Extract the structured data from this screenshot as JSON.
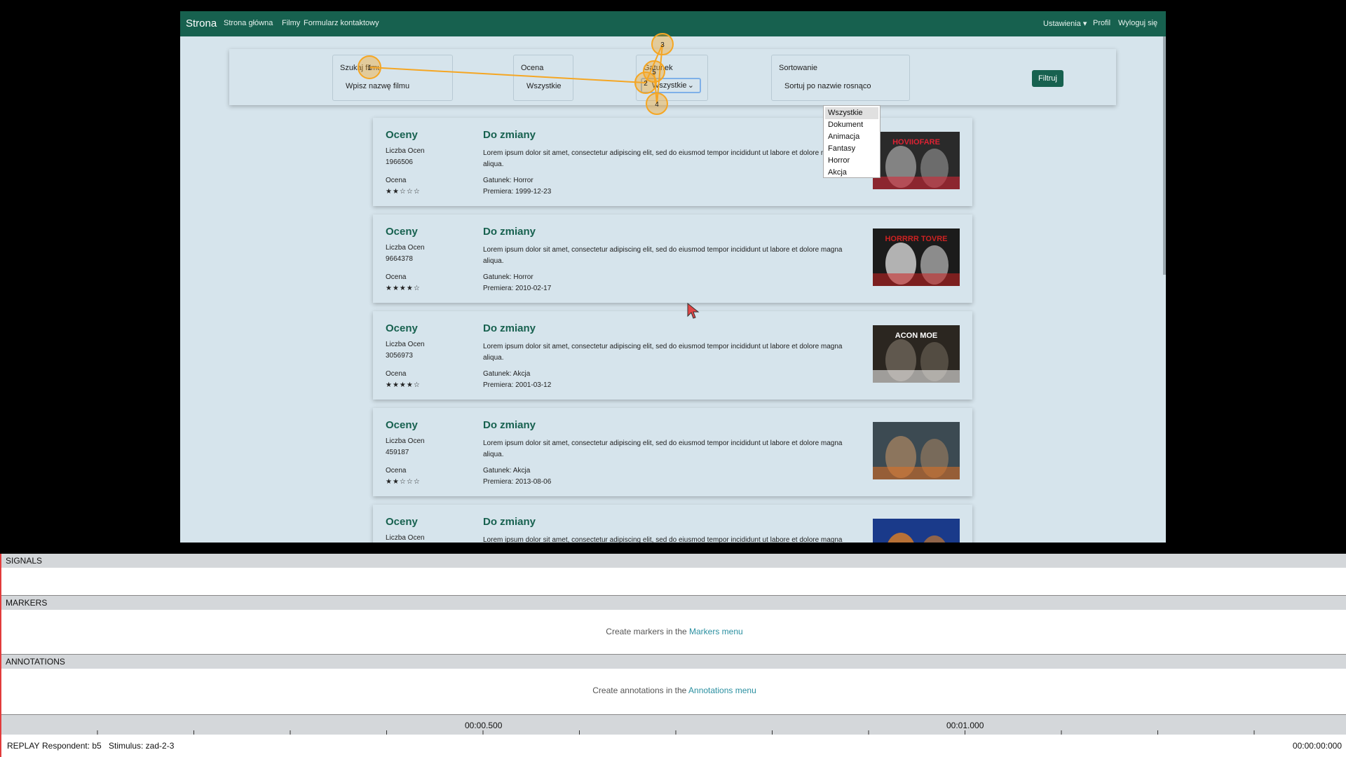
{
  "site": {
    "brand": "Strona",
    "nav": [
      "Strona główna",
      "Filmy",
      "Formularz kontaktowy"
    ],
    "right_nav": [
      "Ustawienia ▾",
      "Profil",
      "Wyloguj się"
    ]
  },
  "filters": {
    "search": {
      "label": "Szukaj filmu",
      "placeholder": "Wpisz nazwę filmu"
    },
    "rating": {
      "label": "Ocena",
      "value": "Wszystkie"
    },
    "genre": {
      "label": "Gatunek",
      "value": "Wszystkie",
      "options": [
        "Wszystkie",
        "Dokument",
        "Animacja",
        "Fantasy",
        "Horror",
        "Akcja"
      ]
    },
    "sort": {
      "label": "Sortowanie",
      "value": "Sortuj po nazwie rosnąco"
    },
    "button": "Filtruj"
  },
  "movies": [
    {
      "rating_title": "Oceny",
      "count_label": "Liczba Ocen",
      "count": "1966506",
      "score_label": "Ocena",
      "stars": "★★☆☆☆",
      "title": "Do zmiany",
      "desc": "Lorem ipsum dolor sit amet, consectetur adipiscing elit, sed do eiusmod tempor incididunt ut labore et dolore magna aliqua.",
      "genre": "Gatunek: Horror",
      "premiere": "Premiera: 1999-12-23",
      "poster_text": "HOVIIOFARE",
      "poster_colors": [
        "#2a2a2a",
        "#9a9a9a",
        "#d23"
      ]
    },
    {
      "rating_title": "Oceny",
      "count_label": "Liczba Ocen",
      "count": "9664378",
      "score_label": "Ocena",
      "stars": "★★★★☆",
      "title": "Do zmiany",
      "desc": "Lorem ipsum dolor sit amet, consectetur adipiscing elit, sed do eiusmod tempor incididunt ut labore et dolore magna aliqua.",
      "genre": "Gatunek: Horror",
      "premiere": "Premiera: 2010-02-17",
      "poster_text": "HORRRR TOVRE",
      "poster_colors": [
        "#1b1b1b",
        "#d8d8d8",
        "#c22"
      ]
    },
    {
      "rating_title": "Oceny",
      "count_label": "Liczba Ocen",
      "count": "3056973",
      "score_label": "Ocena",
      "stars": "★★★★☆",
      "title": "Do zmiany",
      "desc": "Lorem ipsum dolor sit amet, consectetur adipiscing elit, sed do eiusmod tempor incididunt ut labore et dolore magna aliqua.",
      "genre": "Gatunek: Akcja",
      "premiere": "Premiera: 2001-03-12",
      "poster_text": "ACON MOE",
      "poster_colors": [
        "#2b2620",
        "#6e655a",
        "#fff"
      ]
    },
    {
      "rating_title": "Oceny",
      "count_label": "Liczba Ocen",
      "count": "459187",
      "score_label": "Ocena",
      "stars": "★★☆☆☆",
      "title": "Do zmiany",
      "desc": "Lorem ipsum dolor sit amet, consectetur adipiscing elit, sed do eiusmod tempor incididunt ut labore et dolore magna aliqua.",
      "genre": "Gatunek: Akcja",
      "premiere": "Premiera: 2013-08-06",
      "poster_text": "",
      "poster_colors": [
        "#3c4a52",
        "#a08060",
        "#e07020"
      ]
    },
    {
      "rating_title": "Oceny",
      "count_label": "Liczba Ocen",
      "count": "",
      "score_label": "",
      "stars": "",
      "title": "Do zmiany",
      "desc": "Lorem ipsum dolor sit amet, consectetur adipiscing elit, sed do eiusmod tempor incididunt ut labore et dolore magna aliqua.",
      "genre": "",
      "premiere": "",
      "poster_text": "",
      "poster_colors": [
        "#1a3a8a",
        "#e08020",
        "#c03030"
      ]
    }
  ],
  "gaze": {
    "fixation_labels": [
      "1",
      "2",
      "3",
      "4",
      "5"
    ],
    "color": "#f5a623"
  },
  "panels": {
    "signals": "SIGNALS",
    "markers": "MARKERS",
    "markers_msg": "Create markers in the ",
    "markers_link": "Markers menu",
    "annotations": "ANNOTATIONS",
    "annotations_msg": "Create annotations in the ",
    "annotations_link": "Annotations menu"
  },
  "timeline": {
    "t1": "00:00.500",
    "t2": "00:01.000"
  },
  "status": {
    "mode": "REPLAY",
    "respondent": "Respondent: b5",
    "stimulus": "Stimulus: zad-2-3",
    "time": "00:00:00:000"
  }
}
